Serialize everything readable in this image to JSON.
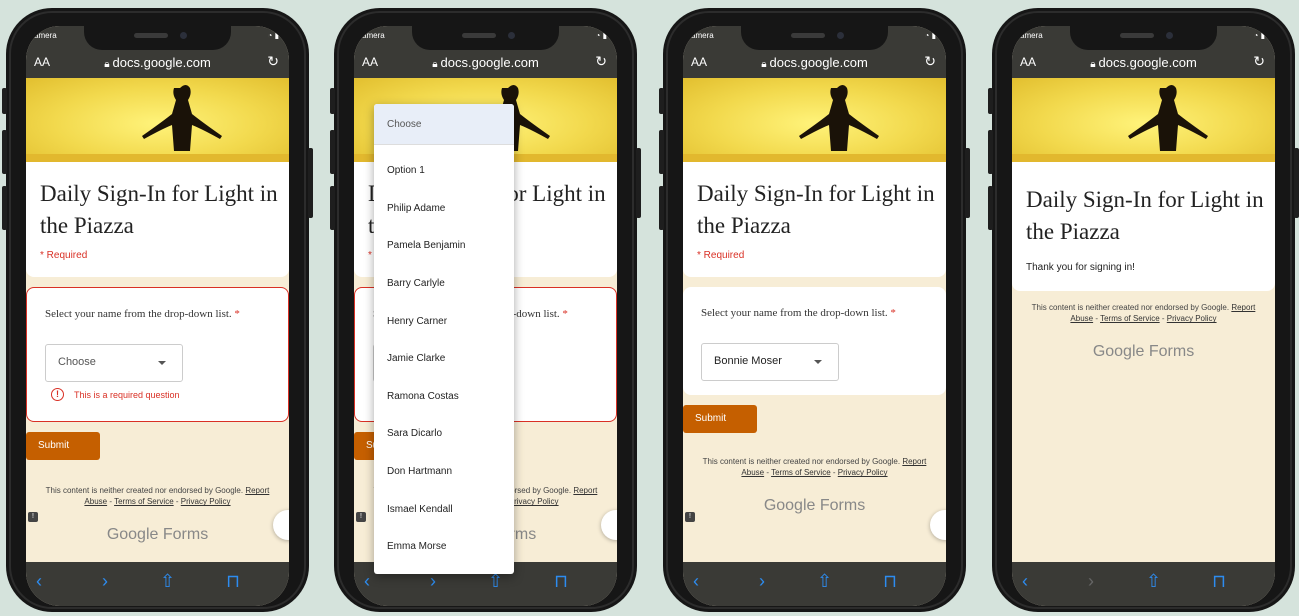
{
  "browser": {
    "carrier": "amera",
    "url": "docs.google.com",
    "aa": "AA"
  },
  "form": {
    "title_line1": "Daily Sign-In for Light in",
    "title_line2": "the Piazza",
    "required": "* Required",
    "question": "Select your name from the drop-down list.",
    "asterisk": "*",
    "placeholder": "Choose",
    "error": "This is a required question",
    "submit": "Submit",
    "selected_value": "Bonnie Moser",
    "thanks": "Thank you for signing in!"
  },
  "footer": {
    "line1": "This content is neither created nor endorsed by Google.",
    "report": "Report",
    "abuse": "Abuse",
    "terms": "Terms of Service",
    "privacy": "Privacy Policy",
    "brand_google": "Google",
    "brand_forms": "Forms"
  },
  "dropdown": {
    "options": [
      "Choose",
      "Option 1",
      "Philip Adame",
      "Pamela Benjamin",
      "Barry Carlyle",
      "Henry Carner",
      "Jamie Clarke",
      "Ramona Costas",
      "Sara Dicarlo",
      "Don Hartmann",
      "Ismael Kendall",
      "Emma Morse"
    ]
  },
  "colors": {
    "accent": "#c55f00",
    "error": "#d93025",
    "banner": "#f2d94d",
    "safari_blue": "#2d8cf0"
  }
}
